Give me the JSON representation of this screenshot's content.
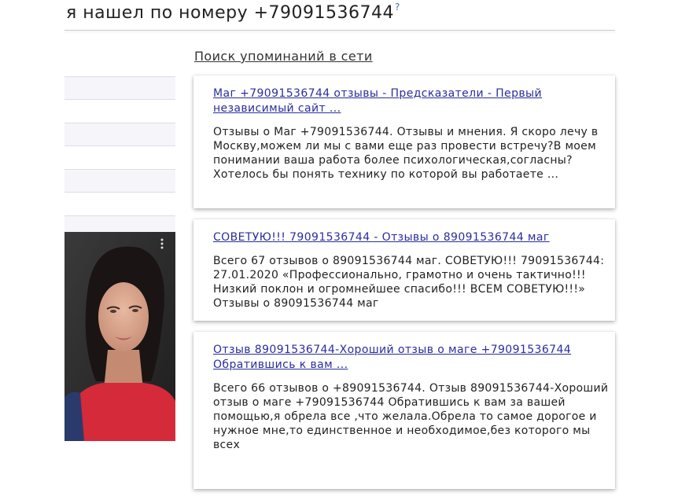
{
  "header": {
    "title": "я нашел по номеру +79091536744",
    "help_mark": "?"
  },
  "mentions": {
    "label": "Поиск упоминаний в сети"
  },
  "sidebar": {
    "items": [
      "",
      "",
      "",
      ""
    ]
  },
  "results": [
    {
      "title": "Маг +79091536744 отзывы - Предсказатели - Первый независимый сайт ...",
      "snippet": "Отзывы о Маг +79091536744. Отзывы и мнения. Я скоро лечу в Москву,можем ли мы с вами еще раз провести встречу?В моем понимании ваша работа более психологическая,согласны?Хотелось бы понять технику по которой вы работаете ..."
    },
    {
      "title": "СОВЕТУЮ!!! 79091536744 - Отзывы о 89091536744 маг",
      "snippet": "Всего 67 отзывов о 89091536744 маг. СОВЕТУЮ!!! 79091536744: 27.01.2020 «Профессионально, грамотно и очень тактично!!! Низкий поклон и огромнейшее спасибо!!! ВСЕМ СОВЕТУЮ!!!» Отзывы о 89091536744 маг"
    },
    {
      "title": "Отзыв 89091536744-Хороший отзыв о маге +79091536744 Обратившись к вам ...",
      "snippet": "Всего 66 отзывов о +89091536744. Отзыв 89091536744-Хороший отзыв о маге +79091536744 Обратившись к вам за вашей помощью,я обрела все ,что желала.Обрела то самое дорогое и нужное мне,то единственное и необходимое,без которого мы всех"
    }
  ],
  "colors": {
    "link": "#2a2e9c",
    "text": "#222222",
    "sidebar_bg": "#f6f5f9"
  }
}
